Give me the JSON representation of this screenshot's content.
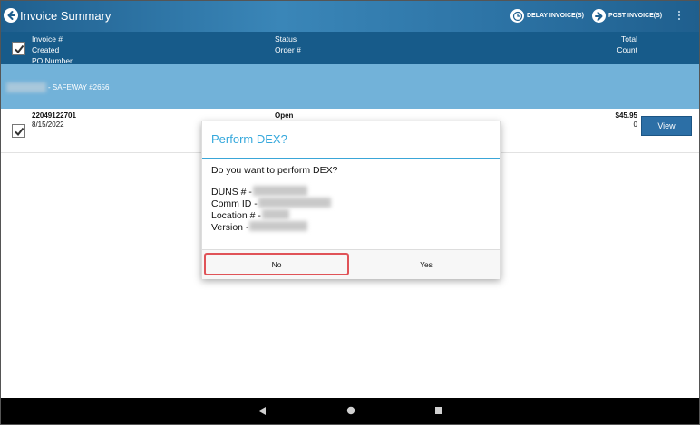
{
  "app": {
    "title": "Invoice Summary",
    "delay_label": "DELAY INVOICE(S)",
    "post_label": "POST INVOICE(S)"
  },
  "header": {
    "col1": [
      "Invoice #",
      "Created",
      "PO Number"
    ],
    "col2": [
      "Status",
      "Order #"
    ],
    "col3": [
      "Total",
      "Count"
    ]
  },
  "group": {
    "label": "- SAFEWAY #2656"
  },
  "invoice": {
    "number": "22049122701",
    "created": "8/15/2022",
    "status": "Open",
    "total": "$45.95",
    "count": "0",
    "view_label": "View"
  },
  "dialog": {
    "title": "Perform DEX?",
    "question": "Do you want to perform DEX?",
    "duns_label": "DUNS # -",
    "comm_label": "Comm ID -",
    "location_label": "Location # -",
    "version_label": "Version -",
    "no_label": "No",
    "yes_label": "Yes"
  },
  "colors": {
    "appbar": "#2d74a6",
    "header": "#175b8a",
    "group": "#72b2d9",
    "accent": "#35a8dc",
    "highlight": "#e05358"
  }
}
